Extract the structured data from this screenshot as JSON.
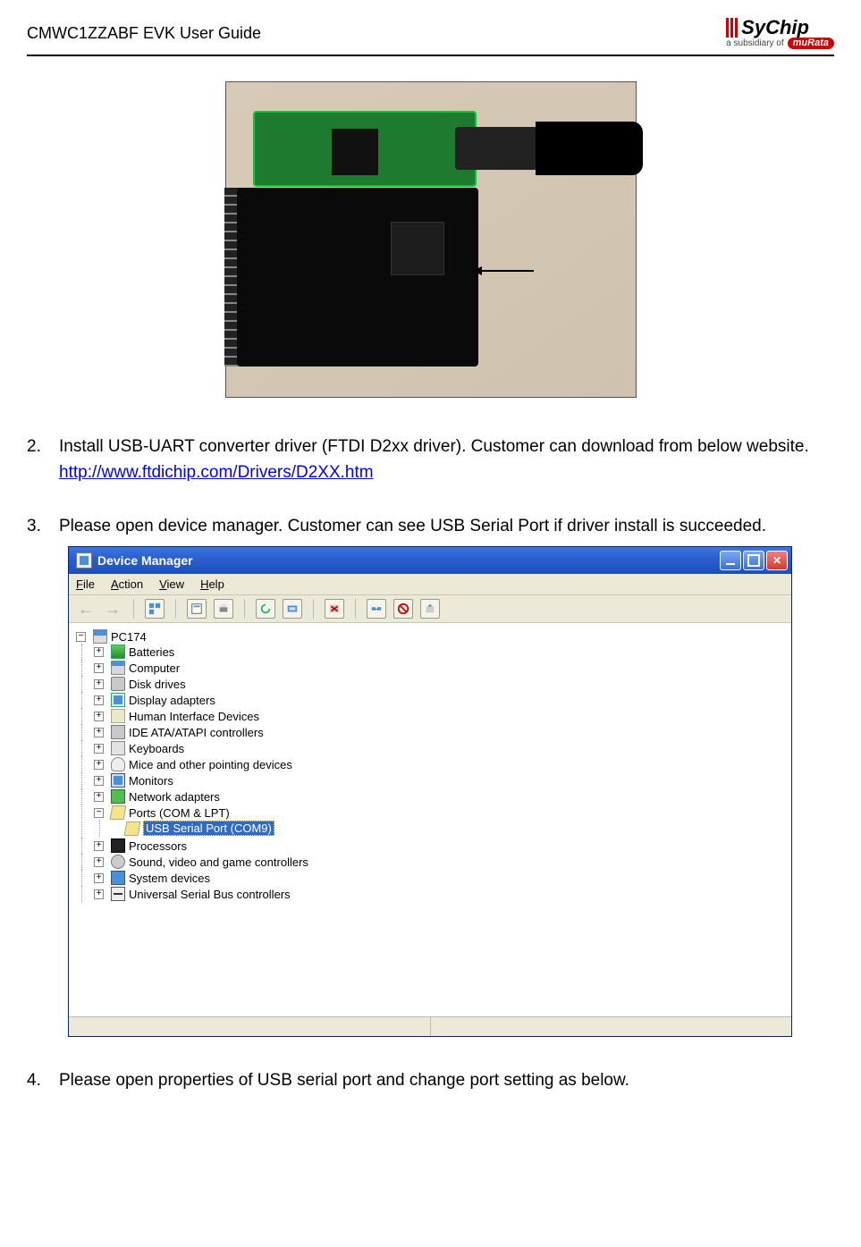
{
  "header": {
    "title": "CMWC1ZZABF EVK User Guide",
    "logo_name": "SyChip",
    "logo_sub_prefix": "a subsidiary of",
    "logo_sub_brand": "muRata"
  },
  "steps": {
    "s2_num": "2.",
    "s2_text": "Install USB-UART converter driver (FTDI D2xx driver). Customer can download from below website.",
    "s2_link": "http://www.ftdichip.com/Drivers/D2XX.htm",
    "s3_num": "3.",
    "s3_text": "Please open device manager. Customer can see USB Serial Port if driver install is succeeded.",
    "s4_num": "4.",
    "s4_text": "Please open properties of USB serial port and change port setting as below."
  },
  "dm": {
    "title": "Device Manager",
    "menus": {
      "file": "File",
      "action": "Action",
      "view": "View",
      "help": "Help"
    },
    "toolbar_icons": {
      "back": "back-arrow-icon",
      "fwd": "forward-arrow-icon",
      "up": "tree-view-icon",
      "prop": "properties-icon",
      "print": "print-icon",
      "refresh": "refresh-icon",
      "scan": "scan-hardware-icon",
      "uninstall": "uninstall-icon",
      "net1": "network-scan-icon",
      "disable": "disable-device-icon",
      "update": "update-driver-icon"
    },
    "root": "PC174",
    "nodes": {
      "batteries": "Batteries",
      "computer": "Computer",
      "disk": "Disk drives",
      "display": "Display adapters",
      "hid": "Human Interface Devices",
      "ide": "IDE ATA/ATAPI controllers",
      "keyboards": "Keyboards",
      "mice": "Mice and other pointing devices",
      "monitors": "Monitors",
      "network": "Network adapters",
      "ports": "Ports (COM & LPT)",
      "usb_serial": "USB Serial Port (COM9)",
      "processors": "Processors",
      "sound": "Sound, video and game controllers",
      "system": "System devices",
      "usb": "Universal Serial Bus controllers"
    },
    "exp_plus": "+",
    "exp_minus": "−"
  }
}
